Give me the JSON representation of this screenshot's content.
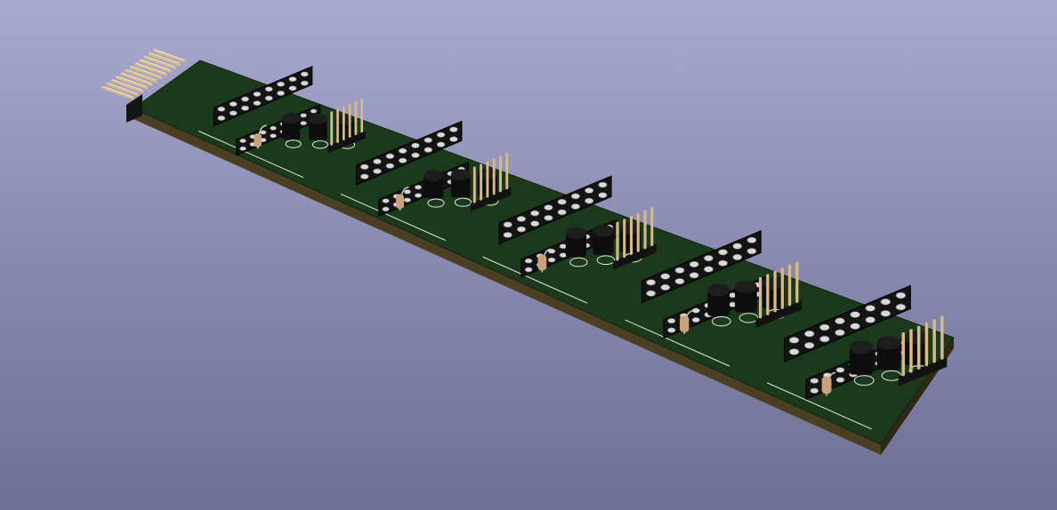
{
  "viewer": {
    "background_top": "#a9aad0",
    "background_bottom": "#6e6f92"
  },
  "board": {
    "type": "pcb-3d-render",
    "soldermask_color": "#1b3a1c",
    "edge_color": "#4a3f22",
    "silkscreen_color": "#e6e6e6",
    "header_pin_color": "#d8b98a",
    "component_body_color": "#111111",
    "resistor_color": "#c9a27a",
    "module_count": 5,
    "edge_connector_pin_count": 12
  },
  "module_components": [
    {
      "kind": "dip-socket",
      "name": "ic-socket"
    },
    {
      "kind": "to92",
      "name": "transistor"
    },
    {
      "kind": "to92",
      "name": "transistor"
    },
    {
      "kind": "to92",
      "name": "transistor"
    },
    {
      "kind": "pin-header",
      "name": "pin-header"
    },
    {
      "kind": "resistor",
      "name": "resistor"
    }
  ]
}
